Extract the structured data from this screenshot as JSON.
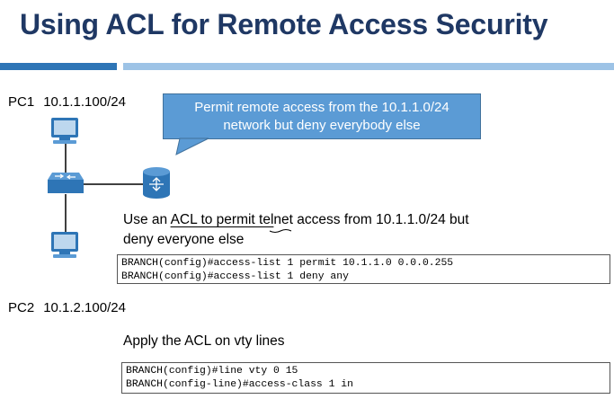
{
  "slide": {
    "title": "Using ACL for Remote Access Security"
  },
  "hosts": {
    "pc1": {
      "name": "PC1",
      "address": "10.1.1.100/24"
    },
    "pc2": {
      "name": "PC2",
      "address": "10.1.2.100/24"
    }
  },
  "callout": {
    "line1": "Permit remote access from the 10.1.1.0/24",
    "line2": "network but deny everybody else"
  },
  "step1": {
    "line1_prefix": "Use an ",
    "line1_underlined": "ACL to permit tel",
    "line1_suffix": "net access from 10.1.1.0/24 but",
    "line2": "deny everyone else",
    "commands": [
      "BRANCH(config)#access-list 1 permit 10.1.1.0 0.0.0.255",
      "BRANCH(config)#access-list 1 deny any"
    ]
  },
  "step2": {
    "text": "Apply the ACL on vty lines",
    "commands": [
      "BRANCH(config)#line vty 0 15",
      "BRANCH(config-line)#access-class 1 in"
    ]
  },
  "colors": {
    "title": "#1f3864",
    "accent_bar": "#2e75b6",
    "light_bar": "#9dc3e6",
    "callout": "#5b9bd5",
    "device": "#2e75b6"
  }
}
